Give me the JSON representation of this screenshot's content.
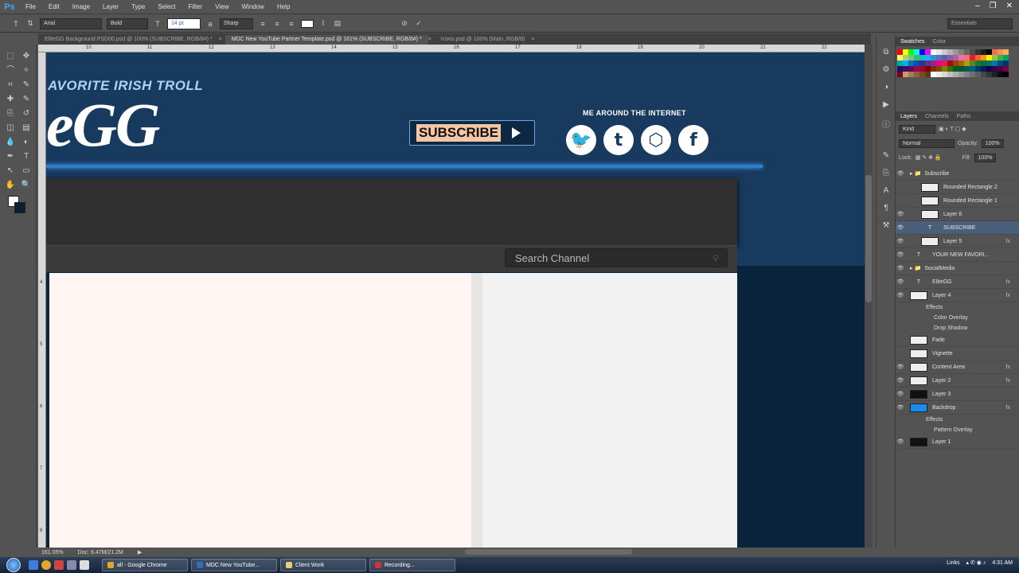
{
  "app": {
    "logo": "Ps"
  },
  "menu": [
    "File",
    "Edit",
    "Image",
    "Layer",
    "Type",
    "Select",
    "Filter",
    "View",
    "Window",
    "Help"
  ],
  "options": {
    "font_family": "Arial",
    "font_style": "Bold",
    "font_size": "14 pt",
    "antialias": "Sharp",
    "workspace": "Essentials"
  },
  "tabs": [
    {
      "label": "EliteGG Background PSD00.psd @ 100% (SUBSCRIBE, RGB/8#) *",
      "active": false
    },
    {
      "label": "MDC New YouTube Partner Template.psd @ 161% (SUBSCRIBE, RGB/8#) *",
      "active": true
    },
    {
      "label": "Icons.psd @ 100% (Main, RGB/8)",
      "active": false
    }
  ],
  "ruler_h": [
    "10",
    "11",
    "12",
    "13",
    "14",
    "15",
    "16",
    "17",
    "18",
    "19",
    "20",
    "21",
    "22",
    "23"
  ],
  "ruler_v": [
    "4",
    "5",
    "6",
    "7",
    "8"
  ],
  "canvas": {
    "tagline": "AVORITE IRISH TROLL",
    "logo_text": "eGG",
    "subscribe_label": "SUBSCRIBE",
    "around_label": "ME AROUND THE INTERNET",
    "social_icons": [
      "twitter-icon",
      "tumblr-icon",
      "cube-icon",
      "facebook-icon"
    ],
    "social_glyphs": [
      "🐦",
      "t",
      "⬡",
      "f"
    ],
    "search_placeholder": "Search Channel"
  },
  "status": {
    "zoom": "161.05%",
    "doc": "Doc: 6.47M/21.2M"
  },
  "panels": {
    "top_tabs": [
      "Swatches",
      "Color"
    ],
    "layer_tabs": [
      "Layers",
      "Channels",
      "Paths"
    ],
    "kind": "Kind",
    "blend_mode": "Normal",
    "opacity_label": "Opacity:",
    "opacity": "100%",
    "lock_label": "Lock:",
    "fill_label": "Fill:",
    "fill": "100%"
  },
  "swatch_colors": [
    "#ff0000",
    "#ffff00",
    "#00ff00",
    "#00ffff",
    "#0000ff",
    "#ff00ff",
    "#ffffff",
    "#e6e6e6",
    "#cccccc",
    "#b3b3b3",
    "#999999",
    "#808080",
    "#666666",
    "#4d4d4d",
    "#333333",
    "#1a1a1a",
    "#000000",
    "#f26c4f",
    "#f68e56",
    "#fbaf5d",
    "#fff568",
    "#acd372",
    "#7cc576",
    "#3bb878",
    "#1abbb4",
    "#00bff3",
    "#438ccb",
    "#5574b9",
    "#605ca8",
    "#855fa8",
    "#a763a8",
    "#f06ea9",
    "#f26d7d",
    "#ed1c24",
    "#f26522",
    "#f7941d",
    "#fff200",
    "#8dc73f",
    "#39b54a",
    "#00a651",
    "#00a99d",
    "#00aeef",
    "#0072bc",
    "#0054a6",
    "#2e3192",
    "#662d91",
    "#92278f",
    "#ec008c",
    "#ed145b",
    "#9e0b0f",
    "#a0410d",
    "#a36209",
    "#aba000",
    "#598527",
    "#1a7b30",
    "#007236",
    "#00746b",
    "#0076a3",
    "#004b80",
    "#003471",
    "#1b1464",
    "#440e62",
    "#630460",
    "#9e005d",
    "#9e0039",
    "#790000",
    "#7b2e00",
    "#7d4900",
    "#827b00",
    "#406618",
    "#005e20",
    "#005826",
    "#005952",
    "#005b7f",
    "#003663",
    "#002157",
    "#0d004c",
    "#32004b",
    "#4b0049",
    "#7b0046",
    "#7a0026",
    "#c69c6d",
    "#a67c52",
    "#8c6239",
    "#754c24",
    "#603913",
    "#ffffff",
    "#ebebeb",
    "#d7d7d7",
    "#c2c2c2",
    "#adadad",
    "#999999",
    "#858585",
    "#707070",
    "#5c5c5c",
    "#474747",
    "#333333",
    "#1f1f1f",
    "#0a0a0a",
    "#000000"
  ],
  "layers": [
    {
      "name": "Subscribe",
      "type": "group",
      "eye": true,
      "indent": 0,
      "fx": false
    },
    {
      "name": "Rounded Rectangle 2",
      "type": "layer",
      "eye": false,
      "indent": 1,
      "fx": false
    },
    {
      "name": "Rounded Rectangle 1",
      "type": "layer",
      "eye": false,
      "indent": 1,
      "fx": false
    },
    {
      "name": "Layer 6",
      "type": "layer",
      "eye": true,
      "indent": 1,
      "fx": false
    },
    {
      "name": "SUBSCRIBE",
      "type": "text",
      "eye": true,
      "indent": 1,
      "fx": false,
      "selected": true
    },
    {
      "name": "Layer 5",
      "type": "layer",
      "eye": true,
      "indent": 1,
      "fx": true
    },
    {
      "name": "YOUR NEW FAVORI...",
      "type": "text",
      "eye": true,
      "indent": 0,
      "fx": false
    },
    {
      "name": "SocialMedia",
      "type": "group",
      "eye": true,
      "indent": 0,
      "fx": false
    },
    {
      "name": "EliteGG",
      "type": "text",
      "eye": true,
      "indent": 0,
      "fx": true
    },
    {
      "name": "Layer 4",
      "type": "layer",
      "eye": true,
      "indent": 0,
      "fx": true,
      "effects": [
        "Effects",
        "Color Overlay",
        "Drop Shadow"
      ]
    },
    {
      "name": "Fade",
      "type": "layer",
      "eye": false,
      "indent": 0,
      "fx": false
    },
    {
      "name": "Vignette",
      "type": "layer",
      "eye": false,
      "indent": 0,
      "fx": false
    },
    {
      "name": "Content Area",
      "type": "layer",
      "eye": true,
      "indent": 0,
      "fx": true
    },
    {
      "name": "Layer 2",
      "type": "layer",
      "eye": true,
      "indent": 0,
      "fx": true
    },
    {
      "name": "Layer 3",
      "type": "layer",
      "eye": true,
      "indent": 0,
      "fx": false
    },
    {
      "name": "Backdrop",
      "type": "layer",
      "eye": true,
      "indent": 0,
      "fx": true,
      "effects": [
        "Effects",
        "Pattern Overlay"
      ]
    },
    {
      "name": "Layer 1",
      "type": "layer",
      "eye": true,
      "indent": 0,
      "fx": false
    }
  ],
  "taskbar": {
    "items": [
      "all - Google Chrome",
      "MDC New YouTube...",
      "Client Work",
      "Recording..."
    ],
    "tray_links": "Links",
    "time": "4:31 AM"
  }
}
